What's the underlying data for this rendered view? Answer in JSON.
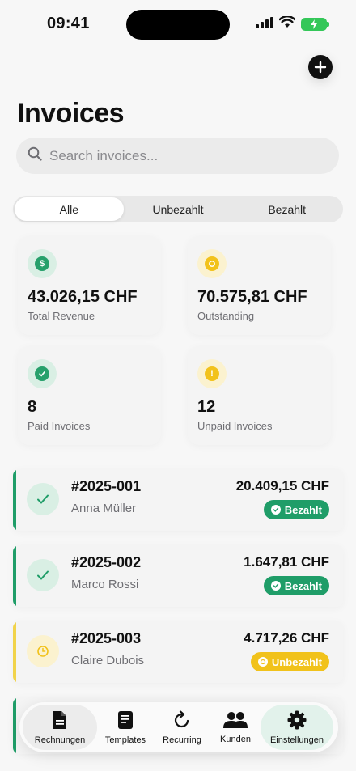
{
  "status_bar": {
    "time": "09:41"
  },
  "header": {
    "title": "Invoices"
  },
  "search": {
    "placeholder": "Search invoices..."
  },
  "filters": [
    {
      "label": "Alle",
      "active": true
    },
    {
      "label": "Unbezahlt",
      "active": false
    },
    {
      "label": "Bezahlt",
      "active": false
    }
  ],
  "stats": [
    {
      "value": "43.026,15 CHF",
      "label": "Total Revenue",
      "icon": "dollar-icon",
      "color": "#27a06b"
    },
    {
      "value": "70.575,81 CHF",
      "label": "Outstanding",
      "icon": "pending-icon",
      "color": "#f2c21b"
    },
    {
      "value": "8",
      "label": "Paid Invoices",
      "icon": "check-icon",
      "color": "#27a06b"
    },
    {
      "value": "12",
      "label": "Unpaid Invoices",
      "icon": "alert-icon",
      "color": "#f2c21b"
    }
  ],
  "invoices": [
    {
      "number": "#2025-001",
      "client": "Anna Müller",
      "amount": "20.409,15 CHF",
      "status": "Bezahlt"
    },
    {
      "number": "#2025-002",
      "client": "Marco Rossi",
      "amount": "1.647,81 CHF",
      "status": "Bezahlt"
    },
    {
      "number": "#2025-003",
      "client": "Claire Dubois",
      "amount": "4.717,26 CHF",
      "status": "Unbezahlt"
    }
  ],
  "tabbar": [
    {
      "label": "Rechnungen",
      "icon": "document-icon",
      "active": true
    },
    {
      "label": "Templates",
      "icon": "template-icon",
      "active": false
    },
    {
      "label": "Recurring",
      "icon": "refresh-icon",
      "active": false
    },
    {
      "label": "Kunden",
      "icon": "people-icon",
      "active": false
    },
    {
      "label": "Einstellungen",
      "icon": "gear-icon",
      "active": false
    }
  ],
  "colors": {
    "paid": "#1f9d68",
    "unpaid": "#f1c21b",
    "battery": "#34c759"
  }
}
